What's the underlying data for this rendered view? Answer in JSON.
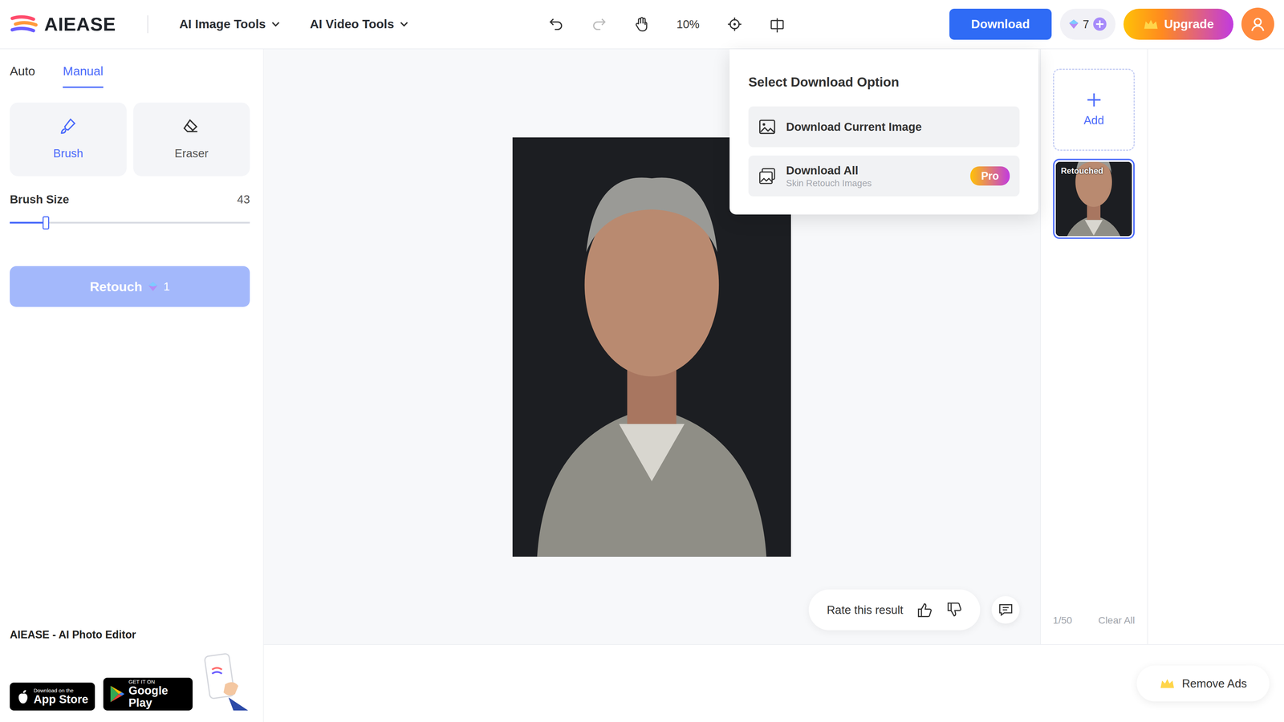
{
  "logo": {
    "text": "AIEASE"
  },
  "menus": [
    {
      "label": "AI Image Tools"
    },
    {
      "label": "AI Video Tools"
    }
  ],
  "toolbar": {
    "zoom": "10%"
  },
  "download_button": {
    "label": "Download"
  },
  "credits": {
    "count": "7"
  },
  "upgrade_button": {
    "label": "Upgrade"
  },
  "download_menu": {
    "title": "Select Download Option",
    "options": [
      {
        "label": "Download Current Image"
      },
      {
        "label": "Download All",
        "subtitle": "Skin Retouch Images",
        "badge": "Pro"
      }
    ]
  },
  "mode_tabs": [
    {
      "label": "Auto",
      "selected": false
    },
    {
      "label": "Manual",
      "selected": true
    }
  ],
  "tools": [
    {
      "label": "Brush",
      "selected": true
    },
    {
      "label": "Eraser",
      "selected": false
    }
  ],
  "brush_size": {
    "label": "Brush Size",
    "reading": "43",
    "level": 0.15
  },
  "retouch_button": {
    "label": "Retouch",
    "cost": "1",
    "disabled": true
  },
  "app_promo": {
    "title": "AIEASE - AI Photo Editor",
    "badges": [
      {
        "small": "Download on the",
        "label": "App Store"
      },
      {
        "small": "GET IT ON",
        "label": "Google Play"
      }
    ]
  },
  "rating": {
    "label": "Rate this result"
  },
  "gallery": {
    "add": "Add",
    "items": [
      {
        "label": "Retouched",
        "selected": true
      }
    ],
    "counter": "1/50",
    "clear": "Clear All"
  },
  "remove_ads": {
    "label": "Remove Ads"
  }
}
